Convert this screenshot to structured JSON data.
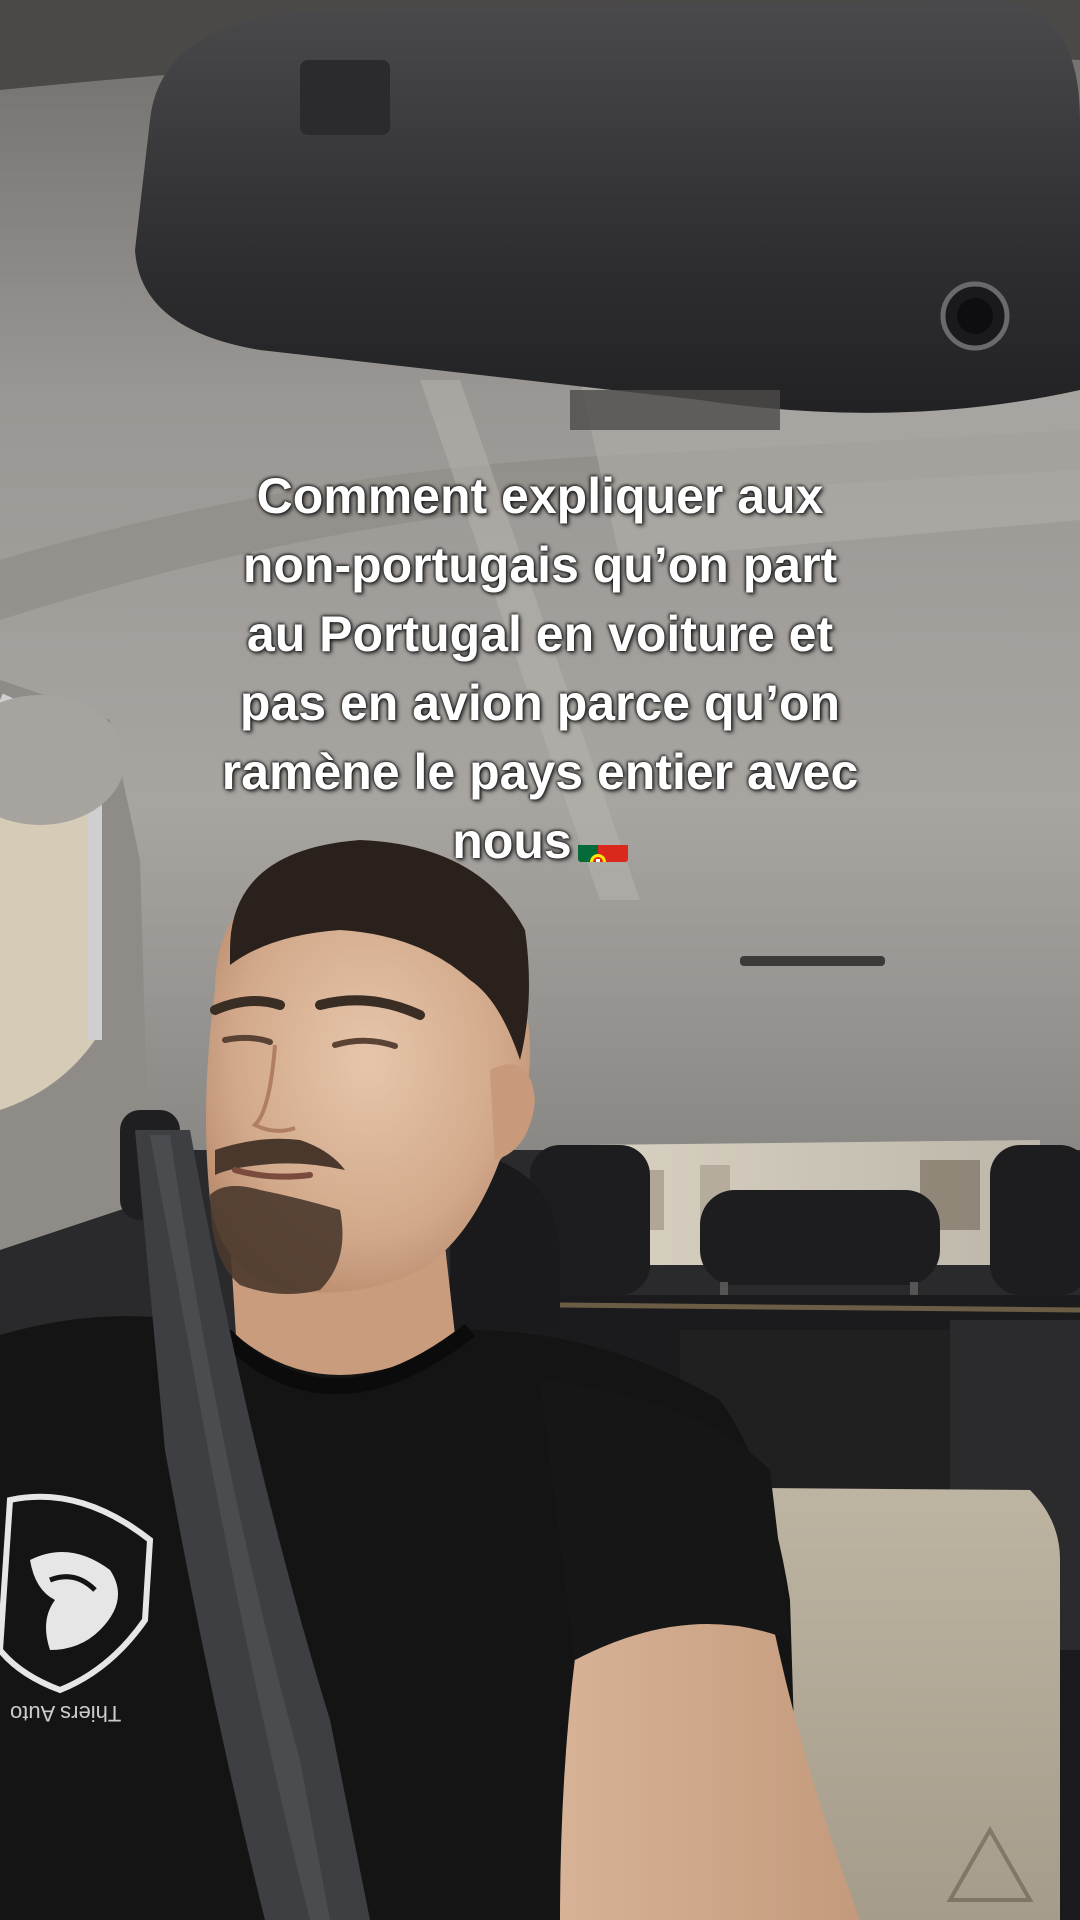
{
  "caption": {
    "lines": [
      "Comment expliquer aux",
      "non-portugais qu’on part",
      "au Portugal en voiture et",
      "pas en avion parce qu’on",
      "ramène le pays entier avec",
      "nous"
    ],
    "flag_emoji": "portugal-flag"
  },
  "shirt": {
    "brand_logo": "PEUGEOT",
    "dealer_text": "Thiers Auto"
  },
  "colors": {
    "caption_text": "#ffffff",
    "shirt": "#141414",
    "seat": "#1b1b1d",
    "headliner": "#9a9794"
  }
}
